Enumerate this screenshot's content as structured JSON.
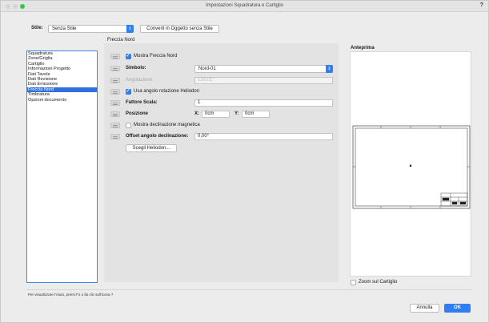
{
  "window": {
    "title": "Impostazioni Squadratura e Cartiglio",
    "help": "?"
  },
  "style": {
    "label": "Stile:",
    "value": "Senza Stile",
    "convert_button": "Converti in Oggetto senza Stile"
  },
  "categories": [
    {
      "label": "Squadratura",
      "selected": false
    },
    {
      "label": "Zone/Griglia",
      "selected": false
    },
    {
      "label": "Cartiglio",
      "selected": false
    },
    {
      "label": "Informazioni Progetto",
      "selected": false
    },
    {
      "label": "Dati Tavole",
      "selected": false
    },
    {
      "label": "Dati Revisione",
      "selected": false
    },
    {
      "label": "Dati Emissione",
      "selected": false
    },
    {
      "label": "Freccia Nord",
      "selected": true
    },
    {
      "label": "Timbratura",
      "selected": false
    },
    {
      "label": "Opzioni documento",
      "selected": false
    }
  ],
  "north_arrow": {
    "section_title": "Freccia Nord",
    "show_arrow_label": "Mostra Freccia Nord",
    "show_arrow_checked": true,
    "symbol_label": "Simbolo:",
    "symbol_value": "Nord-01",
    "angle_label": "Angolazione:",
    "angle_value": "130,01°",
    "use_heliodon_label": "Usa angolo rotazione Heliodon",
    "use_heliodon_checked": true,
    "scale_label": "Fattore Scala:",
    "scale_value": "1",
    "position_label": "Posizione",
    "x_label": "X:",
    "x_value": "0cm",
    "y_label": "Y:",
    "y_value": "0cm",
    "magnetic_label": "Mostra declinazione magnetica",
    "magnetic_checked": false,
    "offset_label": "Offset angolo declinazione:",
    "offset_value": "0,00°",
    "choose_heliodon_button": "Scegli Heliodon..."
  },
  "preview": {
    "title": "Anteprima",
    "zoom_label": "Zoom sul Cartiglio",
    "zoom_checked": false
  },
  "footer": {
    "help_text": "Per visualizzare l'Aiuto, premi F1 o fai clic sull'icona ?",
    "cancel_button": "Annulla",
    "ok_button": "OK"
  },
  "colors": {
    "accent": "#2f7ff2",
    "selection": "#2f6fe0",
    "traffic_close": "#d4d4d4",
    "traffic_min": "#d4d4d4",
    "traffic_zoom": "#2ccb4a"
  }
}
